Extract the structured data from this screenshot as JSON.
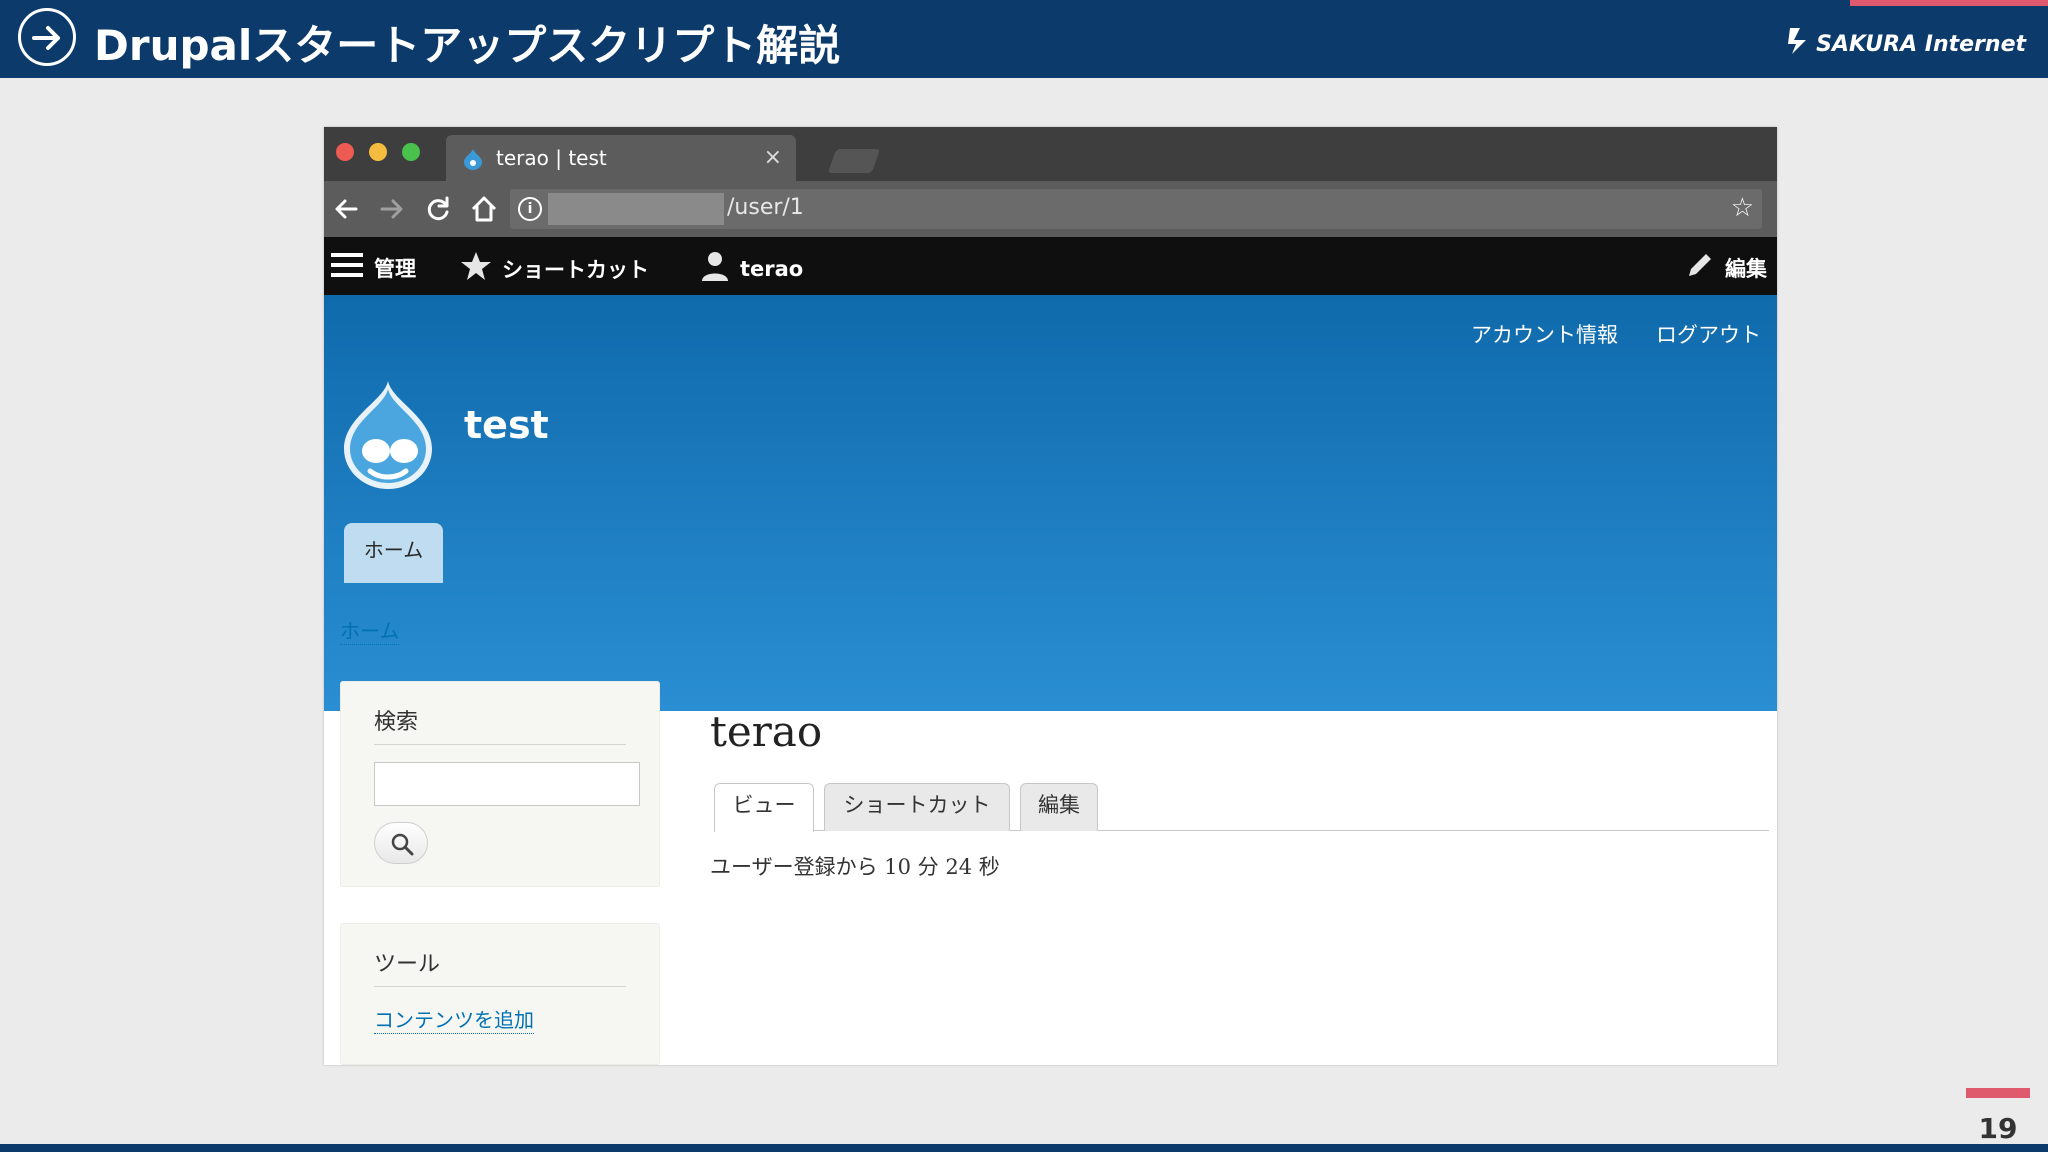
{
  "slide": {
    "title": "Drupalスタートアップスクリプト解説",
    "brand": "SAKURA Internet",
    "page_number": "19"
  },
  "browser": {
    "tab_title": "terao | test",
    "tab_close": "×",
    "url_visible": "/user/1",
    "info_glyph": "i"
  },
  "toolbar": {
    "manage": "管理",
    "shortcuts": "ショートカット",
    "user": "terao",
    "edit": "編集"
  },
  "header": {
    "secondary_menu": [
      "アカウント情報",
      "ログアウト"
    ],
    "site_name": "test",
    "primary_tab": "ホーム"
  },
  "main": {
    "breadcrumb": "ホーム",
    "search_block": {
      "title": "検索"
    },
    "tools_block": {
      "title": "ツール",
      "link": "コンテンツを追加"
    },
    "page_title": "terao",
    "tabs": [
      "ビュー",
      "ショートカット",
      "編集"
    ],
    "member_for": "ユーザー登録から 10 分 24 秒"
  },
  "colors": {
    "slide_header": "#0b3a6b",
    "accent": "#e05a6d",
    "drupal_blue": "#0f6aab",
    "link": "#0071b3"
  },
  "icons": [
    "arrow-right-circle-icon",
    "sakura-logo-icon",
    "drupal-favicon-icon",
    "back-arrow-icon",
    "forward-arrow-icon",
    "reload-icon",
    "home-icon",
    "info-icon",
    "bookmark-star-icon",
    "hamburger-icon",
    "star-icon",
    "user-icon",
    "pencil-icon",
    "drupal-logo-icon",
    "search-icon"
  ]
}
